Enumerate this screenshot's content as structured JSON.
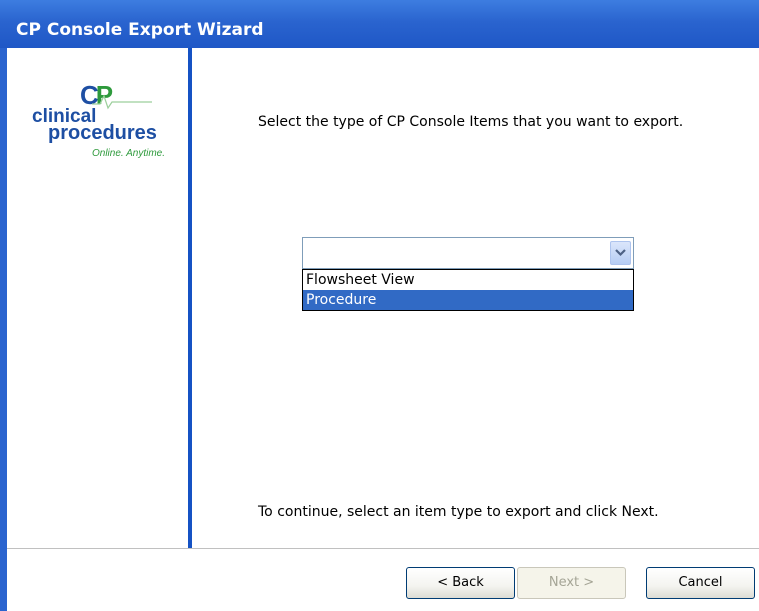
{
  "window": {
    "title": "CP Console Export Wizard"
  },
  "logo": {
    "cp_c": "C",
    "cp_p": "P",
    "line1": "clinical",
    "line2": "procedures",
    "tagline": "Online. Anytime."
  },
  "main": {
    "instruction": "Select the type of CP Console Items that you want to export.",
    "combo": {
      "value": "",
      "options": [
        {
          "label": "Flowsheet View",
          "selected": false
        },
        {
          "label": "Procedure",
          "selected": true
        }
      ]
    },
    "continue_text": "To continue, select an item type to export and click Next."
  },
  "buttons": {
    "back": "< Back",
    "next": "Next >",
    "cancel": "Cancel"
  },
  "colors": {
    "titlebar": "#2a64cf",
    "selection": "#316ac5",
    "sidebar_line": "#1552c4",
    "logo_blue": "#1e4fa3",
    "logo_green": "#2e9a3c"
  }
}
